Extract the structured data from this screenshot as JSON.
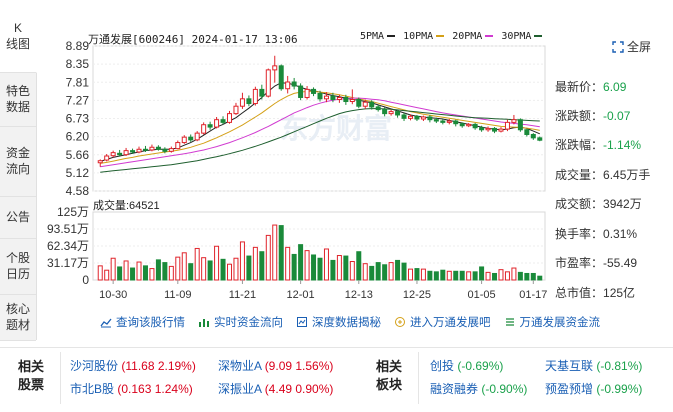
{
  "tabs": [
    {
      "label": "K\n线图",
      "active": true
    },
    {
      "label": "特色\n数据",
      "active": false
    },
    {
      "label": "资金\n流向",
      "active": false
    },
    {
      "label": "公告",
      "active": false
    },
    {
      "label": "个股\n日历",
      "active": false
    },
    {
      "label": "核心\n题材",
      "active": false
    }
  ],
  "header": {
    "stock": "万通发展[600246] 2024-01-17 13:06",
    "ma": [
      {
        "name": "5PMA",
        "color": "#222222"
      },
      {
        "name": "10PMA",
        "color": "#d4a017"
      },
      {
        "name": "20PMA",
        "color": "#d13bd1"
      },
      {
        "name": "30PMA",
        "color": "#1f5f2f"
      }
    ],
    "fullscreen": "全屏"
  },
  "stats": [
    {
      "label": "最新价：",
      "value": "6.09",
      "green": true
    },
    {
      "label": "涨跌额：",
      "value": "-0.07",
      "green": true
    },
    {
      "label": "涨跌幅：",
      "value": "-1.14%",
      "green": true
    },
    {
      "label": "成交量：",
      "value": "6.45万手",
      "green": false
    },
    {
      "label": "成交额：",
      "value": "3942万",
      "green": false
    },
    {
      "label": "换手率：",
      "value": "0.31%",
      "green": false
    },
    {
      "label": "市盈率：",
      "value": "-55.49",
      "green": false
    },
    {
      "label": "总市值：",
      "value": "125亿",
      "green": false
    }
  ],
  "chart_data": {
    "type": "candlestick",
    "price_ticks": [
      "8.89",
      "8.35",
      "7.81",
      "7.27",
      "6.73",
      "6.20",
      "5.66",
      "5.12",
      "4.58"
    ],
    "ylim": [
      4.58,
      8.89
    ],
    "volume_label": "成交量:64521",
    "volume_ticks": [
      "125万",
      "93.51万",
      "62.34万",
      "31.17万",
      "0"
    ],
    "vol_max": 125,
    "x_ticks": [
      "10-30",
      "11-09",
      "11-21",
      "12-01",
      "12-13",
      "12-25",
      "01-05",
      "01-17"
    ],
    "candles": [
      [
        5.42,
        5.48,
        5.3,
        5.52
      ],
      [
        5.5,
        5.62,
        5.46,
        5.68
      ],
      [
        5.63,
        5.72,
        5.58,
        5.78
      ],
      [
        5.7,
        5.66,
        5.6,
        5.8
      ],
      [
        5.66,
        5.78,
        5.62,
        5.86
      ],
      [
        5.78,
        5.74,
        5.68,
        5.84
      ],
      [
        5.74,
        5.82,
        5.7,
        5.9
      ],
      [
        5.82,
        5.8,
        5.74,
        5.92
      ],
      [
        5.8,
        5.88,
        5.76,
        5.96
      ],
      [
        5.88,
        5.82,
        5.78,
        5.94
      ],
      [
        5.82,
        5.76,
        5.7,
        5.88
      ],
      [
        5.76,
        5.84,
        5.72,
        5.9
      ],
      [
        5.84,
        6.02,
        5.82,
        6.08
      ],
      [
        6.02,
        6.18,
        5.98,
        6.24
      ],
      [
        6.18,
        6.1,
        6.04,
        6.26
      ],
      [
        6.1,
        6.3,
        6.06,
        6.36
      ],
      [
        6.3,
        6.55,
        6.26,
        6.62
      ],
      [
        6.55,
        6.48,
        6.4,
        6.64
      ],
      [
        6.48,
        6.7,
        6.44,
        6.78
      ],
      [
        6.7,
        6.62,
        6.56,
        6.8
      ],
      [
        6.62,
        6.88,
        6.58,
        6.96
      ],
      [
        6.88,
        7.1,
        6.84,
        7.2
      ],
      [
        7.1,
        7.32,
        7.02,
        7.5
      ],
      [
        7.32,
        7.18,
        7.1,
        7.42
      ],
      [
        7.18,
        7.6,
        7.12,
        7.68
      ],
      [
        7.6,
        7.4,
        7.3,
        7.74
      ],
      [
        7.4,
        8.18,
        7.36,
        8.22
      ],
      [
        8.18,
        8.3,
        7.8,
        8.6
      ],
      [
        8.3,
        7.62,
        7.56,
        8.34
      ],
      [
        7.62,
        7.82,
        7.48,
        8.0
      ],
      [
        7.82,
        7.7,
        7.6,
        7.94
      ],
      [
        7.7,
        7.36,
        7.28,
        7.78
      ],
      [
        7.36,
        7.6,
        7.3,
        7.7
      ],
      [
        7.6,
        7.48,
        7.4,
        7.66
      ],
      [
        7.48,
        7.32,
        7.24,
        7.56
      ],
      [
        7.32,
        7.4,
        7.22,
        7.52
      ],
      [
        7.4,
        7.3,
        7.22,
        7.5
      ],
      [
        7.3,
        7.36,
        7.2,
        7.44
      ],
      [
        7.36,
        7.24,
        7.14,
        7.44
      ],
      [
        7.24,
        7.3,
        7.16,
        7.6
      ],
      [
        7.3,
        7.1,
        7.04,
        7.36
      ],
      [
        7.1,
        7.22,
        7.02,
        7.3
      ],
      [
        7.22,
        7.08,
        7.0,
        7.28
      ],
      [
        7.08,
        7.0,
        6.94,
        7.14
      ],
      [
        7.0,
        6.88,
        6.8,
        7.06
      ],
      [
        6.88,
        6.94,
        6.82,
        7.0
      ],
      [
        6.94,
        6.84,
        6.76,
        6.98
      ],
      [
        6.84,
        6.74,
        6.66,
        6.9
      ],
      [
        6.74,
        6.8,
        6.68,
        6.86
      ],
      [
        6.8,
        6.72,
        6.66,
        6.84
      ],
      [
        6.72,
        6.78,
        6.66,
        6.82
      ],
      [
        6.78,
        6.7,
        6.62,
        6.84
      ],
      [
        6.7,
        6.66,
        6.6,
        6.76
      ],
      [
        6.66,
        6.62,
        6.56,
        6.72
      ],
      [
        6.62,
        6.66,
        6.56,
        6.72
      ],
      [
        6.66,
        6.58,
        6.5,
        6.7
      ],
      [
        6.58,
        6.52,
        6.46,
        6.62
      ],
      [
        6.52,
        6.56,
        6.48,
        6.6
      ],
      [
        6.56,
        6.46,
        6.4,
        6.6
      ],
      [
        6.46,
        6.4,
        6.34,
        6.52
      ],
      [
        6.4,
        6.44,
        6.34,
        6.5
      ],
      [
        6.44,
        6.36,
        6.3,
        6.48
      ],
      [
        6.36,
        6.42,
        6.32,
        6.48
      ],
      [
        6.42,
        6.62,
        6.36,
        6.7
      ],
      [
        6.62,
        6.7,
        6.56,
        6.84
      ],
      [
        6.7,
        6.4,
        6.34,
        6.74
      ],
      [
        6.4,
        6.26,
        6.2,
        6.42
      ],
      [
        6.26,
        6.16,
        6.1,
        6.3
      ],
      [
        6.16,
        6.09,
        6.06,
        6.2
      ]
    ],
    "volumes": [
      26,
      18,
      40,
      24,
      35,
      22,
      33,
      26,
      21,
      37,
      32,
      25,
      42,
      50,
      30,
      58,
      41,
      35,
      62,
      38,
      29,
      40,
      70,
      44,
      60,
      52,
      82,
      101,
      100,
      60,
      47,
      65,
      54,
      46,
      40,
      57,
      36,
      45,
      44,
      34,
      52,
      30,
      25,
      32,
      28,
      32,
      36,
      31,
      20,
      21,
      20,
      16,
      15,
      18,
      16,
      16,
      16,
      15,
      15,
      24,
      14,
      12,
      19,
      15,
      22,
      14,
      12,
      12,
      7
    ],
    "ma_series": {
      "5PMA": [
        5.46,
        5.52,
        5.58,
        5.62,
        5.66,
        5.7,
        5.74,
        5.78,
        5.8,
        5.82,
        5.82,
        5.82,
        5.86,
        5.94,
        6.02,
        6.12,
        6.24,
        6.36,
        6.48,
        6.56,
        6.66,
        6.76,
        6.9,
        7.04,
        7.2,
        7.36,
        7.54,
        7.7,
        7.8,
        7.78,
        7.74,
        7.66,
        7.6,
        7.56,
        7.52,
        7.46,
        7.42,
        7.38,
        7.34,
        7.3,
        7.28,
        7.24,
        7.2,
        7.14,
        7.08,
        7.02,
        6.96,
        6.9,
        6.84,
        6.8,
        6.78,
        6.76,
        6.74,
        6.72,
        6.68,
        6.64,
        6.6,
        6.56,
        6.52,
        6.48,
        6.44,
        6.42,
        6.4,
        6.42,
        6.46,
        6.48,
        6.44,
        6.36,
        6.28
      ],
      "10PMA": [
        5.4,
        5.43,
        5.47,
        5.51,
        5.55,
        5.58,
        5.62,
        5.65,
        5.68,
        5.71,
        5.74,
        5.76,
        5.79,
        5.83,
        5.88,
        5.94,
        6.0,
        6.08,
        6.16,
        6.25,
        6.34,
        6.44,
        6.54,
        6.66,
        6.78,
        6.9,
        7.04,
        7.18,
        7.3,
        7.4,
        7.48,
        7.52,
        7.54,
        7.54,
        7.52,
        7.5,
        7.47,
        7.44,
        7.4,
        7.36,
        7.32,
        7.28,
        7.24,
        7.19,
        7.14,
        7.09,
        7.04,
        6.99,
        6.94,
        6.9,
        6.86,
        6.83,
        6.8,
        6.77,
        6.74,
        6.71,
        6.68,
        6.65,
        6.62,
        6.59,
        6.56,
        6.53,
        6.5,
        6.49,
        6.48,
        6.47,
        6.45,
        6.42,
        6.38
      ],
      "20PMA": [
        5.3,
        5.33,
        5.36,
        5.39,
        5.42,
        5.45,
        5.48,
        5.51,
        5.54,
        5.57,
        5.6,
        5.63,
        5.66,
        5.69,
        5.72,
        5.76,
        5.8,
        5.85,
        5.9,
        5.96,
        6.02,
        6.09,
        6.16,
        6.24,
        6.32,
        6.41,
        6.5,
        6.6,
        6.7,
        6.8,
        6.9,
        6.98,
        7.06,
        7.13,
        7.19,
        7.24,
        7.28,
        7.31,
        7.33,
        7.34,
        7.34,
        7.33,
        7.31,
        7.29,
        7.26,
        7.22,
        7.18,
        7.14,
        7.1,
        7.06,
        7.02,
        6.98,
        6.94,
        6.9,
        6.87,
        6.84,
        6.81,
        6.78,
        6.75,
        6.72,
        6.69,
        6.66,
        6.63,
        6.61,
        6.59,
        6.57,
        6.55,
        6.52,
        6.49
      ],
      "30PMA": [
        5.14,
        5.16,
        5.18,
        5.2,
        5.22,
        5.24,
        5.26,
        5.28,
        5.3,
        5.32,
        5.34,
        5.36,
        5.39,
        5.42,
        5.45,
        5.48,
        5.52,
        5.56,
        5.6,
        5.64,
        5.69,
        5.74,
        5.79,
        5.85,
        5.91,
        5.97,
        6.04,
        6.11,
        6.18,
        6.26,
        6.34,
        6.42,
        6.5,
        6.58,
        6.66,
        6.74,
        6.81,
        6.88,
        6.93,
        6.97,
        7.0,
        7.02,
        7.03,
        7.03,
        7.02,
        7.01,
        6.99,
        6.97,
        6.95,
        6.93,
        6.91,
        6.89,
        6.87,
        6.85,
        6.83,
        6.81,
        6.79,
        6.77,
        6.76,
        6.75,
        6.74,
        6.73,
        6.72,
        6.71,
        6.7,
        6.69,
        6.68,
        6.67,
        6.66
      ]
    }
  },
  "links": [
    {
      "icon": "chart-icon",
      "label": "查询该股行情"
    },
    {
      "icon": "bars-icon",
      "label": "实时资金流向"
    },
    {
      "icon": "data-icon",
      "label": "深度数据揭秘"
    },
    {
      "icon": "entry-icon",
      "label": "进入万通发展吧"
    },
    {
      "icon": "flow-icon",
      "label": "万通发展资金流"
    }
  ],
  "related": {
    "stocks_title": "相关\n股票",
    "stocks": [
      {
        "name": "沙河股份",
        "value": "(11.68 2.19%)",
        "up": true
      },
      {
        "name": "深物业A",
        "value": "(9.09 1.56%)",
        "up": true
      },
      {
        "name": "市北B股",
        "value": "(0.163 1.24%)",
        "up": true
      },
      {
        "name": "深振业A",
        "value": "(4.49 0.90%)",
        "up": true
      }
    ],
    "sectors_title": "相关\n板块",
    "sectors": [
      {
        "name": "创投",
        "value": "(-0.69%)",
        "up": false
      },
      {
        "name": "天基互联",
        "value": "(-0.81%)",
        "up": false
      },
      {
        "name": "融资融券",
        "value": "(-0.90%)",
        "up": false
      },
      {
        "name": "预盈预增",
        "value": "(-0.99%)",
        "up": false
      }
    ]
  }
}
